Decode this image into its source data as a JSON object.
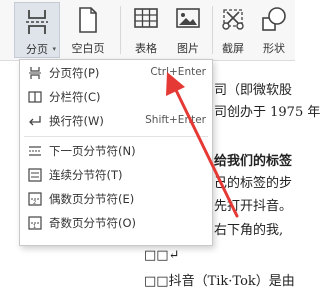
{
  "ribbon": {
    "page_break": "分页",
    "blank_page": "空白页",
    "table": "表格",
    "image": "图片",
    "screenshot": "截屏",
    "shape": "形状"
  },
  "menu": {
    "items": [
      {
        "label": "分页符(P)",
        "shortcut": "Ctrl+Enter"
      },
      {
        "label": "分栏符(C)",
        "shortcut": ""
      },
      {
        "label": "换行符(W)",
        "shortcut": "Shift+Enter"
      },
      {
        "label": "下一页分节符(N)",
        "shortcut": ""
      },
      {
        "label": "连续分节符(T)",
        "shortcut": ""
      },
      {
        "label": "偶数页分节符(E)",
        "shortcut": ""
      },
      {
        "label": "奇数页分节符(O)",
        "shortcut": ""
      }
    ]
  },
  "doc": {
    "line1": "司（即微软股",
    "line2": "司创办于 1975 年",
    "line3": "给我们的标签",
    "line4": "己的标签的步",
    "line5": "先打开抖音。",
    "line6": "右下角的我,",
    "line7": "□□↵",
    "line8": "□□抖音（Tik·Tok）是由"
  },
  "colors": {
    "arrow": "#e53935",
    "accent": "#4a6fa5"
  }
}
